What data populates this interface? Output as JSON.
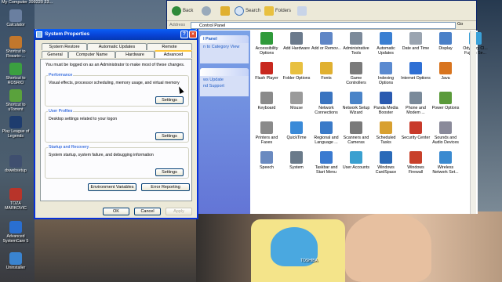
{
  "desktop": {
    "top_label": "My Computer  399220 23...",
    "icons": [
      {
        "label": "Calculator",
        "icon": "calculator-icon",
        "color": "#6a7fa0"
      },
      {
        "label": "Shortcut to Rosario-...",
        "icon": "shortcut-icon",
        "color": "#c2772c"
      },
      {
        "label": "Shortcut to ROSRIO",
        "icon": "shortcut-icon",
        "color": "#3ba040"
      },
      {
        "label": "Shortcut to uTorrent",
        "icon": "utorrent-icon",
        "color": "#5aa23c"
      },
      {
        "label": "Play League of Legends",
        "icon": "game-icon",
        "color": "#1e3c6e"
      },
      {
        "label": "dxwebsetup",
        "icon": "setup-icon",
        "color": "#3f4f6f"
      },
      {
        "label": "TOZA MARKOVIC",
        "icon": "document-icon",
        "color": "#b8342a"
      },
      {
        "label": "Advanced SystemCare 5",
        "icon": "systemcare-icon",
        "color": "#2a6fd0"
      },
      {
        "label": "Uninstaller",
        "icon": "uninstaller-icon",
        "color": "#3a84d0"
      }
    ]
  },
  "control_panel": {
    "toolbar": {
      "back": "Back",
      "search": "Search",
      "folders": "Folders"
    },
    "address_label": "Address",
    "address_value": "Control Panel",
    "go_label": "Go",
    "side": {
      "panel_title": "l Panel",
      "switch_link": "n to Category View",
      "panel2_links": [
        "ws Update",
        "nd Support"
      ]
    },
    "items": [
      {
        "label": "Accessibility Options",
        "icon": "accessibility-icon",
        "color": "#2f9a3a"
      },
      {
        "label": "Add Hardware",
        "icon": "add-hardware-icon",
        "color": "#6b7a8c"
      },
      {
        "label": "Add or Remov...",
        "icon": "add-remove-icon",
        "color": "#5f86c6"
      },
      {
        "label": "Administrative Tools",
        "icon": "admin-tools-icon",
        "color": "#7c8a9a"
      },
      {
        "label": "Automatic Updates",
        "icon": "updates-icon",
        "color": "#3a7fd2"
      },
      {
        "label": "Date and Time",
        "icon": "clock-icon",
        "color": "#9aa4b0"
      },
      {
        "label": "Display",
        "icon": "display-icon",
        "color": "#4a80c8"
      },
      {
        "label": "Odyssey Cl... Fujitsu Se...",
        "icon": "odyssey-icon",
        "color": "#3aa0d8"
      },
      {
        "label": "Flash Player",
        "icon": "flash-icon",
        "color": "#c8281e"
      },
      {
        "label": "Folder Options",
        "icon": "folder-icon",
        "color": "#e8c040"
      },
      {
        "label": "Fonts",
        "icon": "fonts-icon",
        "color": "#e0b030"
      },
      {
        "label": "Game Controllers",
        "icon": "gamepad-icon",
        "color": "#7a7a7a"
      },
      {
        "label": "Indexing Options",
        "icon": "indexing-icon",
        "color": "#5a8ad0"
      },
      {
        "label": "Internet Options",
        "icon": "internet-icon",
        "color": "#2e6fd4"
      },
      {
        "label": "Java",
        "icon": "java-icon",
        "color": "#d8741e"
      },
      {
        "label": "Keyboard",
        "icon": "keyboard-icon",
        "color": "#8a8a8a"
      },
      {
        "label": "Mouse",
        "icon": "mouse-icon",
        "color": "#9a9a9a"
      },
      {
        "label": "Network Connections",
        "icon": "network-icon",
        "color": "#3a74c0"
      },
      {
        "label": "Network Setup Wizard",
        "icon": "network-wizard-icon",
        "color": "#4a84c8"
      },
      {
        "label": "Panda Media Booster",
        "icon": "panda-icon",
        "color": "#2a5ab0"
      },
      {
        "label": "Phone and Modem ...",
        "icon": "phone-icon",
        "color": "#7a8a9a"
      },
      {
        "label": "Power Options",
        "icon": "power-icon",
        "color": "#5a9a3a"
      },
      {
        "label": "Printers and Faxes",
        "icon": "printer-icon",
        "color": "#8a8a8a"
      },
      {
        "label": "QuickTime",
        "icon": "quicktime-icon",
        "color": "#3a8ad8"
      },
      {
        "label": "Regional and Language ...",
        "icon": "globe-icon",
        "color": "#3a7ac8"
      },
      {
        "label": "Scanners and Cameras",
        "icon": "scanner-icon",
        "color": "#7a7a7a"
      },
      {
        "label": "Scheduled Tasks",
        "icon": "tasks-icon",
        "color": "#d8a030"
      },
      {
        "label": "Security Center",
        "icon": "shield-icon",
        "color": "#c83a2a"
      },
      {
        "label": "Sounds and Audio Devices",
        "icon": "sound-icon",
        "color": "#8a8a9a"
      },
      {
        "label": "Speech",
        "icon": "speech-icon",
        "color": "#6a8ac0"
      },
      {
        "label": "System",
        "icon": "system-icon",
        "color": "#6a7a8a"
      },
      {
        "label": "Taskbar and Start Menu",
        "icon": "taskbar-icon",
        "color": "#3a7ad0"
      },
      {
        "label": "User Accounts",
        "icon": "users-icon",
        "color": "#3aa0d0"
      },
      {
        "label": "Windows CardSpace",
        "icon": "cardspace-icon",
        "color": "#2a6ab8"
      },
      {
        "label": "Windows Firewall",
        "icon": "firewall-icon",
        "color": "#c8402a"
      },
      {
        "label": "Wireless Network Set...",
        "icon": "wireless-icon",
        "color": "#3a8ad0"
      }
    ]
  },
  "dialog": {
    "title": "System Properties",
    "help_glyph": "?",
    "close_glyph": "×",
    "tabs_row1": [
      "System Restore",
      "Automatic Updates",
      "Remote"
    ],
    "tabs_row2": [
      "General",
      "Computer Name",
      "Hardware",
      "Advanced"
    ],
    "notice": "You must be logged on as an Administrator to make most of these changes.",
    "groups": [
      {
        "title": "Performance",
        "desc": "Visual effects, processor scheduling, memory usage, and virtual memory",
        "button": "Settings"
      },
      {
        "title": "User Profiles",
        "desc": "Desktop settings related to your logon",
        "button": "Settings"
      },
      {
        "title": "Startup and Recovery",
        "desc": "System startup, system failure, and debugging information",
        "button": "Settings"
      }
    ],
    "env_button": "Environment Variables",
    "error_button": "Error Reporting",
    "ok": "OK",
    "cancel": "Cancel",
    "apply": "Apply"
  },
  "camera_label": "TOSHIBA"
}
